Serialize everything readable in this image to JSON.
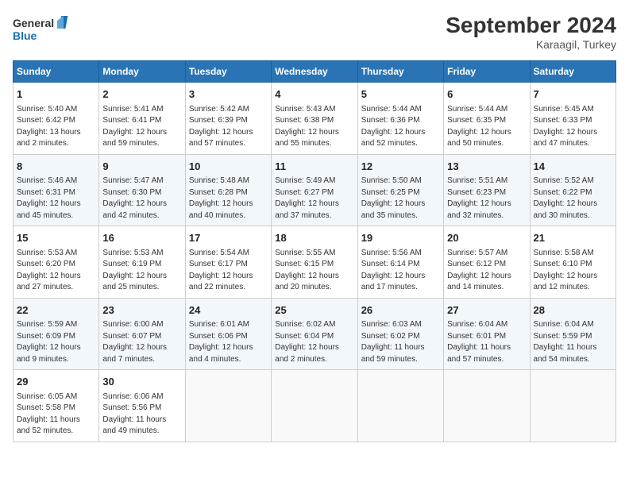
{
  "header": {
    "logo_line1": "General",
    "logo_line2": "Blue",
    "month": "September 2024",
    "location": "Karaagil, Turkey"
  },
  "weekdays": [
    "Sunday",
    "Monday",
    "Tuesday",
    "Wednesday",
    "Thursday",
    "Friday",
    "Saturday"
  ],
  "weeks": [
    [
      {
        "day": "1",
        "info": "Sunrise: 5:40 AM\nSunset: 6:42 PM\nDaylight: 13 hours\nand 2 minutes."
      },
      {
        "day": "2",
        "info": "Sunrise: 5:41 AM\nSunset: 6:41 PM\nDaylight: 12 hours\nand 59 minutes."
      },
      {
        "day": "3",
        "info": "Sunrise: 5:42 AM\nSunset: 6:39 PM\nDaylight: 12 hours\nand 57 minutes."
      },
      {
        "day": "4",
        "info": "Sunrise: 5:43 AM\nSunset: 6:38 PM\nDaylight: 12 hours\nand 55 minutes."
      },
      {
        "day": "5",
        "info": "Sunrise: 5:44 AM\nSunset: 6:36 PM\nDaylight: 12 hours\nand 52 minutes."
      },
      {
        "day": "6",
        "info": "Sunrise: 5:44 AM\nSunset: 6:35 PM\nDaylight: 12 hours\nand 50 minutes."
      },
      {
        "day": "7",
        "info": "Sunrise: 5:45 AM\nSunset: 6:33 PM\nDaylight: 12 hours\nand 47 minutes."
      }
    ],
    [
      {
        "day": "8",
        "info": "Sunrise: 5:46 AM\nSunset: 6:31 PM\nDaylight: 12 hours\nand 45 minutes."
      },
      {
        "day": "9",
        "info": "Sunrise: 5:47 AM\nSunset: 6:30 PM\nDaylight: 12 hours\nand 42 minutes."
      },
      {
        "day": "10",
        "info": "Sunrise: 5:48 AM\nSunset: 6:28 PM\nDaylight: 12 hours\nand 40 minutes."
      },
      {
        "day": "11",
        "info": "Sunrise: 5:49 AM\nSunset: 6:27 PM\nDaylight: 12 hours\nand 37 minutes."
      },
      {
        "day": "12",
        "info": "Sunrise: 5:50 AM\nSunset: 6:25 PM\nDaylight: 12 hours\nand 35 minutes."
      },
      {
        "day": "13",
        "info": "Sunrise: 5:51 AM\nSunset: 6:23 PM\nDaylight: 12 hours\nand 32 minutes."
      },
      {
        "day": "14",
        "info": "Sunrise: 5:52 AM\nSunset: 6:22 PM\nDaylight: 12 hours\nand 30 minutes."
      }
    ],
    [
      {
        "day": "15",
        "info": "Sunrise: 5:53 AM\nSunset: 6:20 PM\nDaylight: 12 hours\nand 27 minutes."
      },
      {
        "day": "16",
        "info": "Sunrise: 5:53 AM\nSunset: 6:19 PM\nDaylight: 12 hours\nand 25 minutes."
      },
      {
        "day": "17",
        "info": "Sunrise: 5:54 AM\nSunset: 6:17 PM\nDaylight: 12 hours\nand 22 minutes."
      },
      {
        "day": "18",
        "info": "Sunrise: 5:55 AM\nSunset: 6:15 PM\nDaylight: 12 hours\nand 20 minutes."
      },
      {
        "day": "19",
        "info": "Sunrise: 5:56 AM\nSunset: 6:14 PM\nDaylight: 12 hours\nand 17 minutes."
      },
      {
        "day": "20",
        "info": "Sunrise: 5:57 AM\nSunset: 6:12 PM\nDaylight: 12 hours\nand 14 minutes."
      },
      {
        "day": "21",
        "info": "Sunrise: 5:58 AM\nSunset: 6:10 PM\nDaylight: 12 hours\nand 12 minutes."
      }
    ],
    [
      {
        "day": "22",
        "info": "Sunrise: 5:59 AM\nSunset: 6:09 PM\nDaylight: 12 hours\nand 9 minutes."
      },
      {
        "day": "23",
        "info": "Sunrise: 6:00 AM\nSunset: 6:07 PM\nDaylight: 12 hours\nand 7 minutes."
      },
      {
        "day": "24",
        "info": "Sunrise: 6:01 AM\nSunset: 6:06 PM\nDaylight: 12 hours\nand 4 minutes."
      },
      {
        "day": "25",
        "info": "Sunrise: 6:02 AM\nSunset: 6:04 PM\nDaylight: 12 hours\nand 2 minutes."
      },
      {
        "day": "26",
        "info": "Sunrise: 6:03 AM\nSunset: 6:02 PM\nDaylight: 11 hours\nand 59 minutes."
      },
      {
        "day": "27",
        "info": "Sunrise: 6:04 AM\nSunset: 6:01 PM\nDaylight: 11 hours\nand 57 minutes."
      },
      {
        "day": "28",
        "info": "Sunrise: 6:04 AM\nSunset: 5:59 PM\nDaylight: 11 hours\nand 54 minutes."
      }
    ],
    [
      {
        "day": "29",
        "info": "Sunrise: 6:05 AM\nSunset: 5:58 PM\nDaylight: 11 hours\nand 52 minutes."
      },
      {
        "day": "30",
        "info": "Sunrise: 6:06 AM\nSunset: 5:56 PM\nDaylight: 11 hours\nand 49 minutes."
      },
      {
        "day": "",
        "info": ""
      },
      {
        "day": "",
        "info": ""
      },
      {
        "day": "",
        "info": ""
      },
      {
        "day": "",
        "info": ""
      },
      {
        "day": "",
        "info": ""
      }
    ]
  ]
}
